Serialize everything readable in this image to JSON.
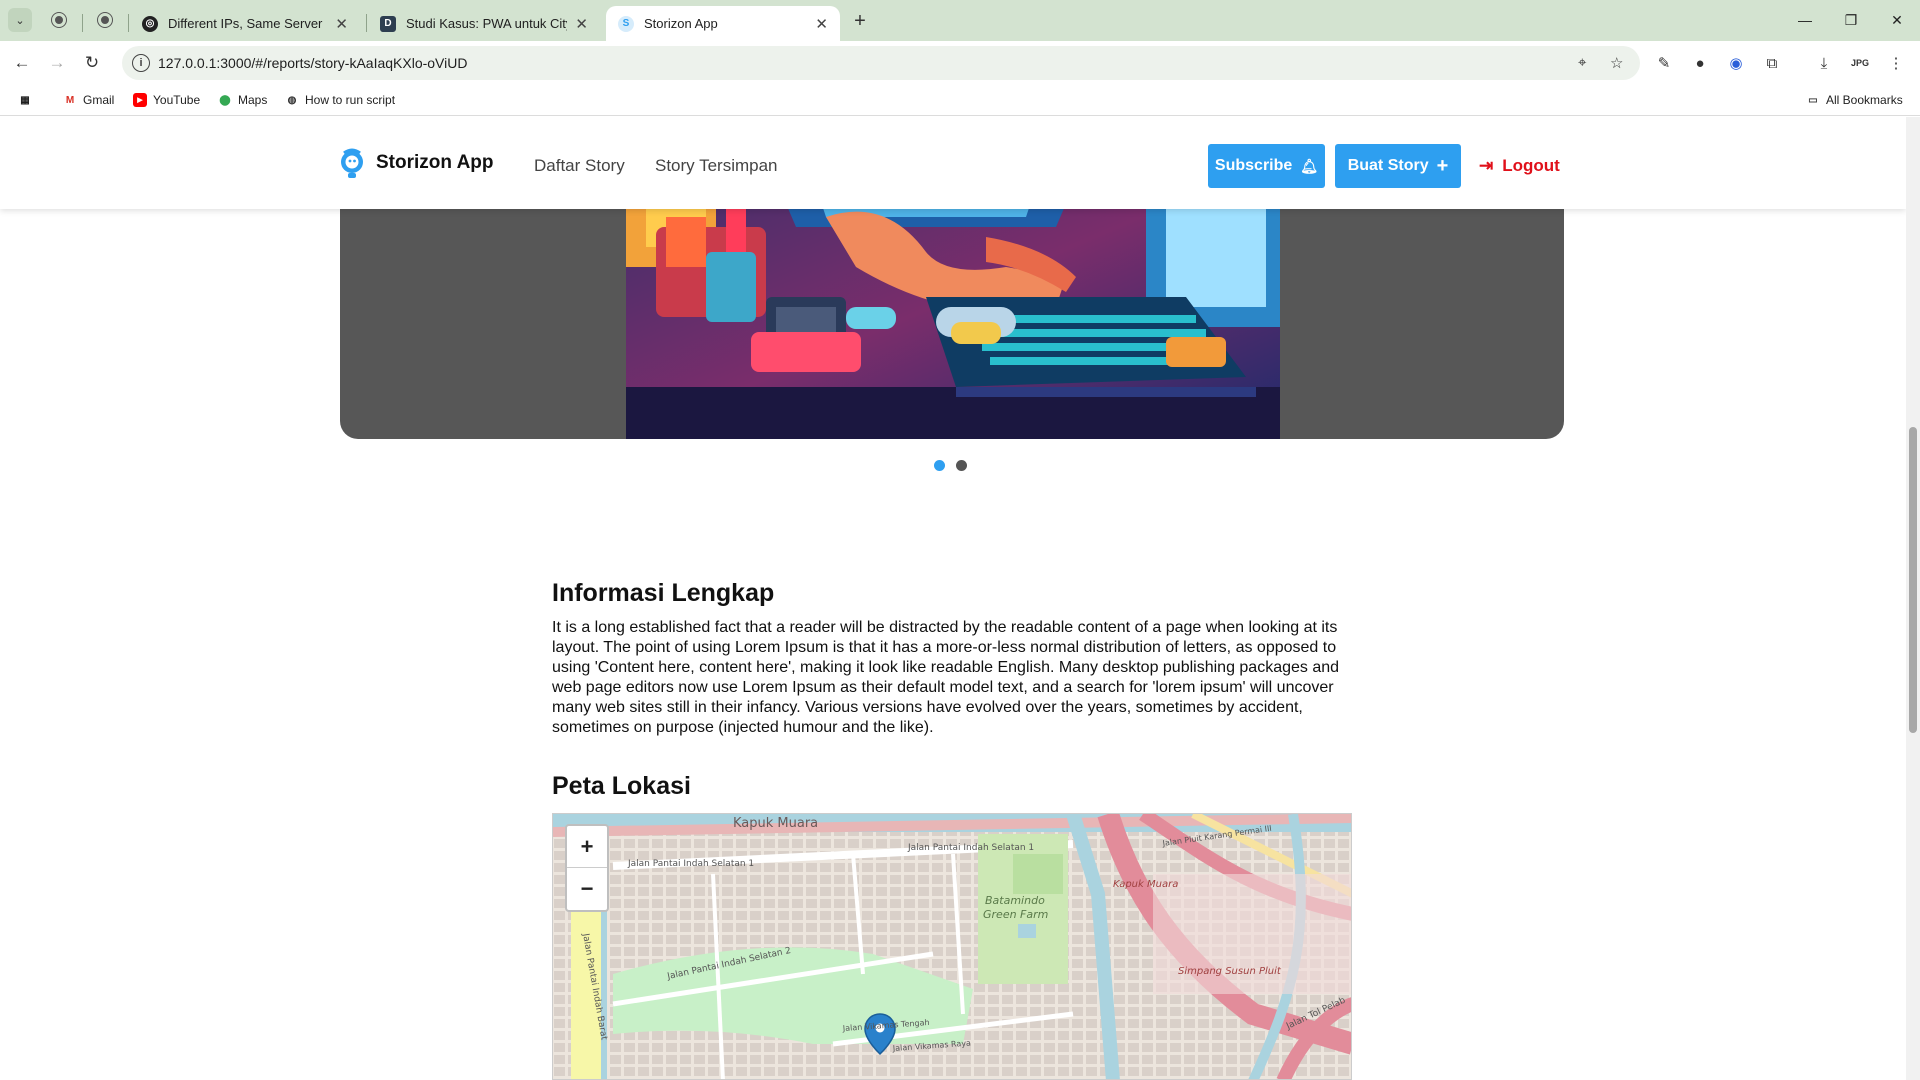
{
  "browser": {
    "tabs": [
      {
        "title": "Different IPs, Same Server",
        "favicon": "openai-icon"
      },
      {
        "title": "Studi Kasus: PWA untuk CityCar",
        "favicon": "dicoding-icon"
      },
      {
        "title": "Storizon App",
        "favicon": "storizon-icon",
        "active": true
      }
    ],
    "new_tab_label": "+",
    "url": "127.0.0.1:3000/#/reports/story-kAaIaqKXlo-oViUD",
    "bookmarks": [
      {
        "label": "Gmail",
        "icon": "gmail-icon"
      },
      {
        "label": "YouTube",
        "icon": "youtube-icon"
      },
      {
        "label": "Maps",
        "icon": "maps-icon"
      },
      {
        "label": "How to run script",
        "icon": "globe-icon"
      }
    ],
    "all_bookmarks": "All Bookmarks",
    "extension_badge": "JPG"
  },
  "header": {
    "brand": "Storizon App",
    "nav": [
      "Daftar Story",
      "Story Tersimpan"
    ],
    "subscribe_label": "Subscribe",
    "create_label": "Buat Story",
    "logout_label": "Logout",
    "accent_color": "#2e9ff0",
    "logout_color": "#e0101a"
  },
  "carousel": {
    "slide_count": 2,
    "active_index": 0
  },
  "details": {
    "heading": "Informasi Lengkap",
    "body": "It is a long established fact that a reader will be distracted by the readable content of a page when looking at its layout. The point of using Lorem Ipsum is that it has a more-or-less normal distribution of letters, as opposed to using 'Content here, content here', making it look like readable English. Many desktop publishing packages and web page editors now use Lorem Ipsum as their default model text, and a search for 'lorem ipsum' will uncover many web sites still in their infancy. Various versions have evolved over the years, sometimes by accident, sometimes on purpose (injected humour and the like)."
  },
  "map": {
    "heading": "Peta Lokasi",
    "zoom_in": "+",
    "zoom_out": "−",
    "labels": {
      "kapuk_muara_top": "Kapuk Muara",
      "pantai_indah_1a": "Jalan Pantai Indah Selatan 1",
      "pantai_indah_1b": "Jalan Pantai Indah Selatan 1",
      "pantai_indah_2": "Jalan Pantai Indah Selatan 2",
      "batamindo": "Batamindo",
      "green_farm": "Green Farm",
      "kapuk_muara_right": "Kapuk Muara",
      "simpang_susun": "Simpang Susun Pluit",
      "pluit_karang": "Jalan Pluit Karang Permai III",
      "vikamas_tengah": "Jalan Vikamas Tengah",
      "vikamas_raya": "Jalan Vikamas Raya",
      "pantai_indah_barat": "Jalan Pantai Indah Barat",
      "tol_pelabuhan": "Jalan Tol Pelab"
    }
  }
}
